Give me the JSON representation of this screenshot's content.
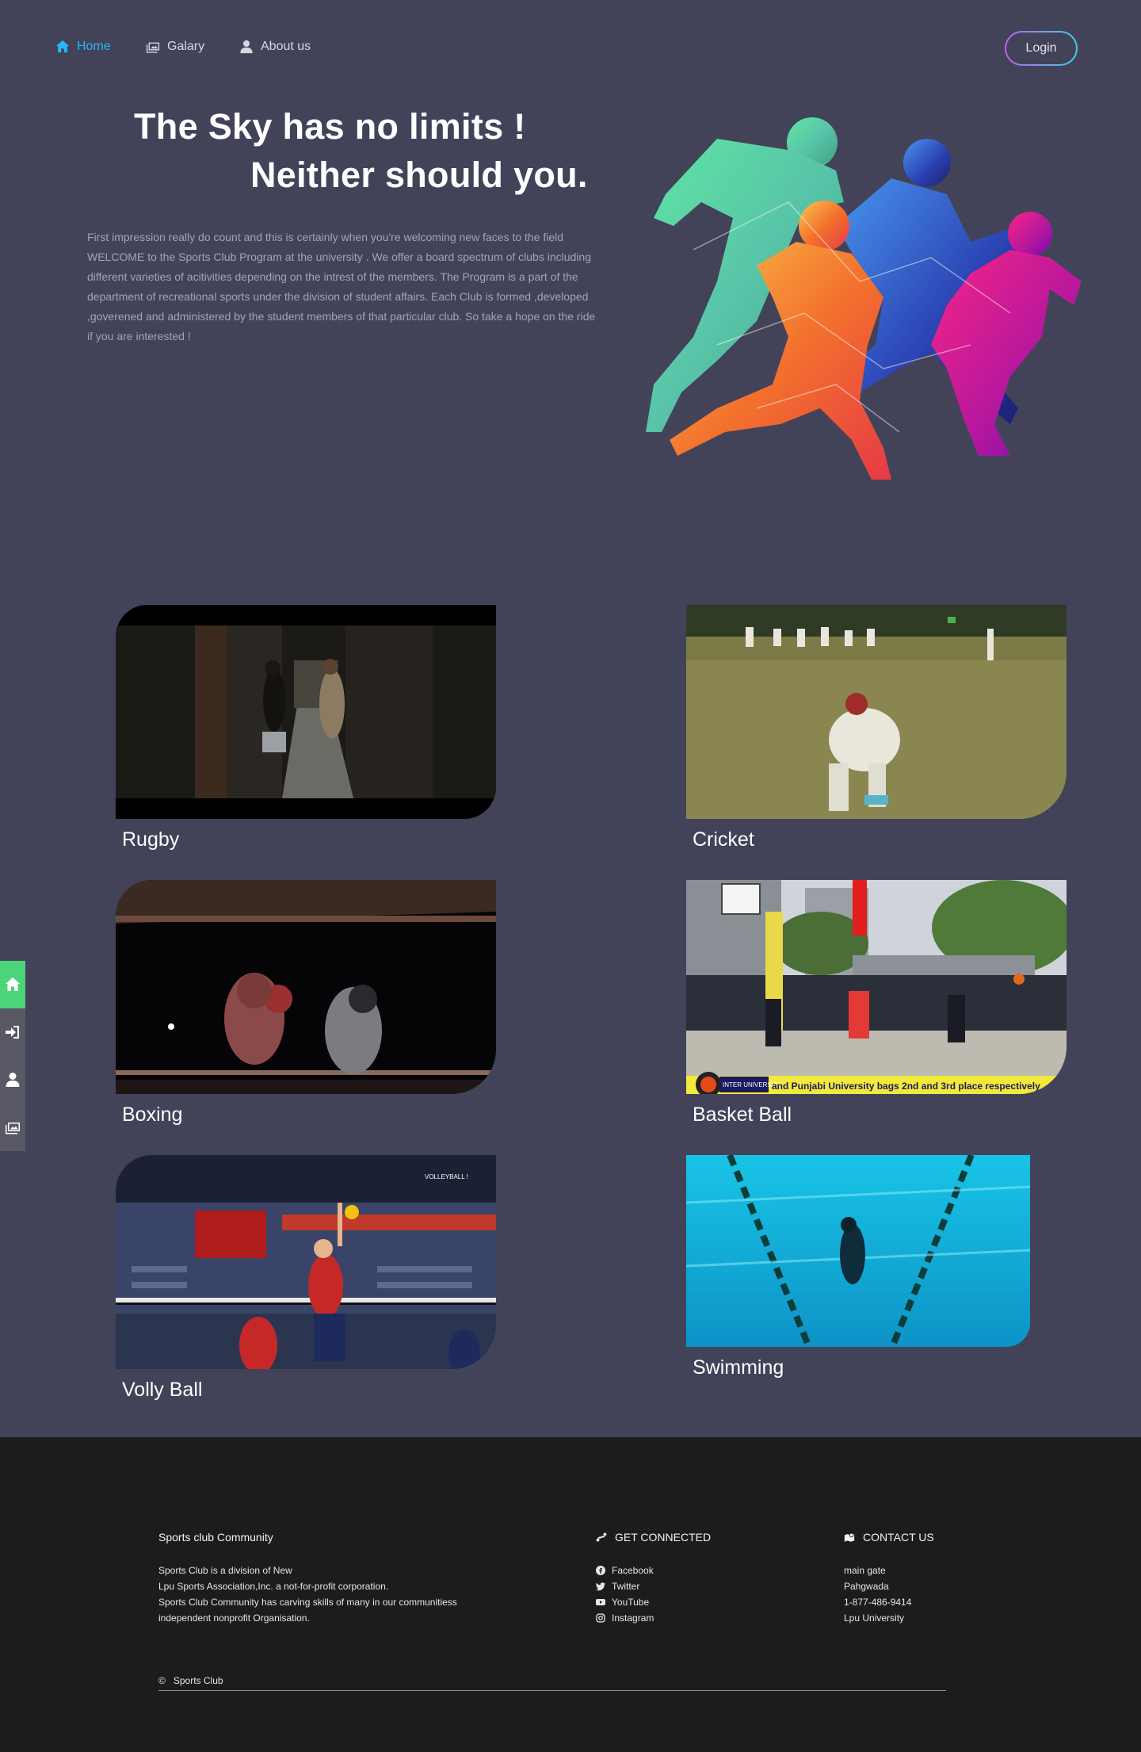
{
  "nav": {
    "items": [
      {
        "label": "Home",
        "icon": "home-icon",
        "active": true
      },
      {
        "label": "Galary",
        "icon": "gallery-icon"
      },
      {
        "label": "About us",
        "icon": "user-icon"
      }
    ],
    "login_label": "Login"
  },
  "hero": {
    "title_line1": "The Sky has no limits !",
    "title_line2": "Neither should you.",
    "paragraph": "First impression really do count and this is certainly when you're welcoming new faces to the field WELCOME to the Sports Club Program at the university . We offer a board spectrum of clubs including different varieties of acitivities depending on the intrest of the members. The Program is a part of the department of recreational sports under the division of student affairs. Each Club is formed ,developed ,goverened and administered by the student members of that particular club. So take a hope on the ride if you are interested !"
  },
  "sports": [
    {
      "label": "Rugby"
    },
    {
      "label": "Cricket"
    },
    {
      "label": "Boxing"
    },
    {
      "label": "Basket Ball",
      "banner_text": "and Punjabi University bags 2nd and 3rd place respectively",
      "badge_text": "INTER UNIVERSITY"
    },
    {
      "label": "Volly Ball",
      "overlay_text": "VOLLEYBALL !"
    },
    {
      "label": "Swimming"
    }
  ],
  "dock": [
    "home-icon",
    "login-icon",
    "user-icon",
    "gallery-icon"
  ],
  "footer": {
    "community": {
      "title": "Sports club Community",
      "lines": [
        "Sports Club is a division of New",
        "Lpu Sports Association,Inc. a not-for-profit corporation.",
        "Sports Club Community has carving skills of many in our communitiess",
        "independent nonprofit Organisation."
      ]
    },
    "connect": {
      "title": "GET CONNECTED",
      "links": [
        "Facebook",
        "Twitter",
        "YouTube",
        "Instagram"
      ]
    },
    "contact": {
      "title": "CONTACT US",
      "lines": [
        "main gate",
        "Pahgwada",
        "1-877-486-9414",
        "Lpu University"
      ]
    },
    "copyright": "Sports Club"
  },
  "colors": {
    "background": "#424359",
    "accent": "#29b6f6",
    "dock_active": "#4cd479",
    "footer": "#1c1c1e"
  }
}
